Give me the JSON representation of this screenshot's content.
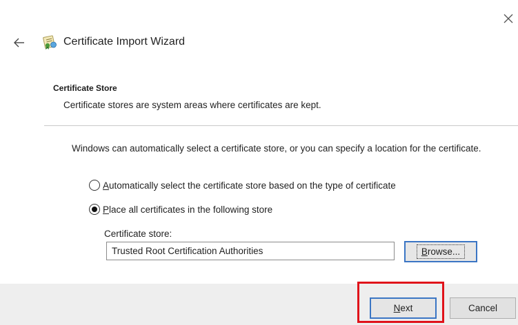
{
  "window": {
    "close_icon": "close-icon",
    "back_icon": "back-arrow-icon",
    "wizard_icon": "certificate-icon",
    "title": "Certificate Import Wizard"
  },
  "section": {
    "title": "Certificate Store",
    "description": "Certificate stores are system areas where certificates are kept."
  },
  "intro": "Windows can automatically select a certificate store, or you can specify a location for the certificate.",
  "options": [
    {
      "accel": "A",
      "label_rest": "utomatically select the certificate store based on the type of certificate",
      "selected": false
    },
    {
      "accel": "P",
      "label_rest": "lace all certificates in the following store",
      "selected": true
    }
  ],
  "store": {
    "label": "Certificate store:",
    "value": "Trusted Root Certification Authorities",
    "browse_accel": "B",
    "browse_rest": "rowse..."
  },
  "footer": {
    "next_accel": "N",
    "next_rest": "ext",
    "cancel_label": "Cancel",
    "highlight_color": "#e0121a"
  }
}
